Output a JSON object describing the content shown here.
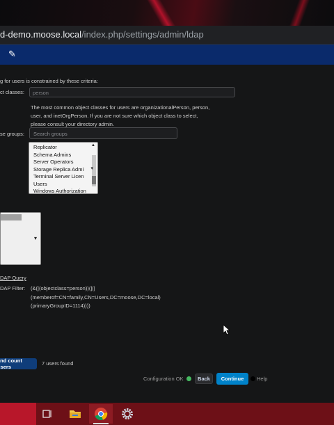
{
  "browser": {
    "url_host": "d-demo.moose.local",
    "url_path": "/index.php/settings/admin/ldap"
  },
  "header": {
    "edit_icon": "pencil-icon"
  },
  "ldap": {
    "criteria_text": "g for users is constrained by these criteria:",
    "object_classes_label": "ct classes:",
    "object_classes_value": "person",
    "object_classes_help": [
      "The most common object classes for users are organizationalPerson, person,",
      "user, and inetOrgPerson. If you are not sure which object class to select,",
      "please consult your directory admin."
    ],
    "groups_label": "se groups:",
    "groups_search_placeholder": "Search groups",
    "groups_list": [
      "Replicator",
      "Schema Admins",
      "Server Operators",
      "Storage Replica Admi",
      "Terminal Server Licen",
      "Users",
      "Windows Authorization"
    ],
    "edit_query_link": "DAP Query",
    "ldap_filter_label": "DAP Filter:",
    "ldap_filter_lines": [
      "(&(|(objectclass=person))(|(|",
      "(memberof=CN=family,CN=Users,DC=moose,DC=local)",
      "(primaryGroupID=1114))))"
    ],
    "count_button": "and count users",
    "users_found": "7 users found",
    "config_status": "Configuration OK",
    "back_button": "Back",
    "continue_button": "Continue",
    "help_link": "Help"
  },
  "colors": {
    "header_blue": "#0a2a6b",
    "button_blue": "#0082c9",
    "status_green": "#46ba61",
    "taskbar_red": "#6d1017"
  },
  "taskbar": {
    "icons": [
      "task-view-icon",
      "file-explorer-icon",
      "chrome-icon",
      "settings-gear-icon"
    ]
  }
}
